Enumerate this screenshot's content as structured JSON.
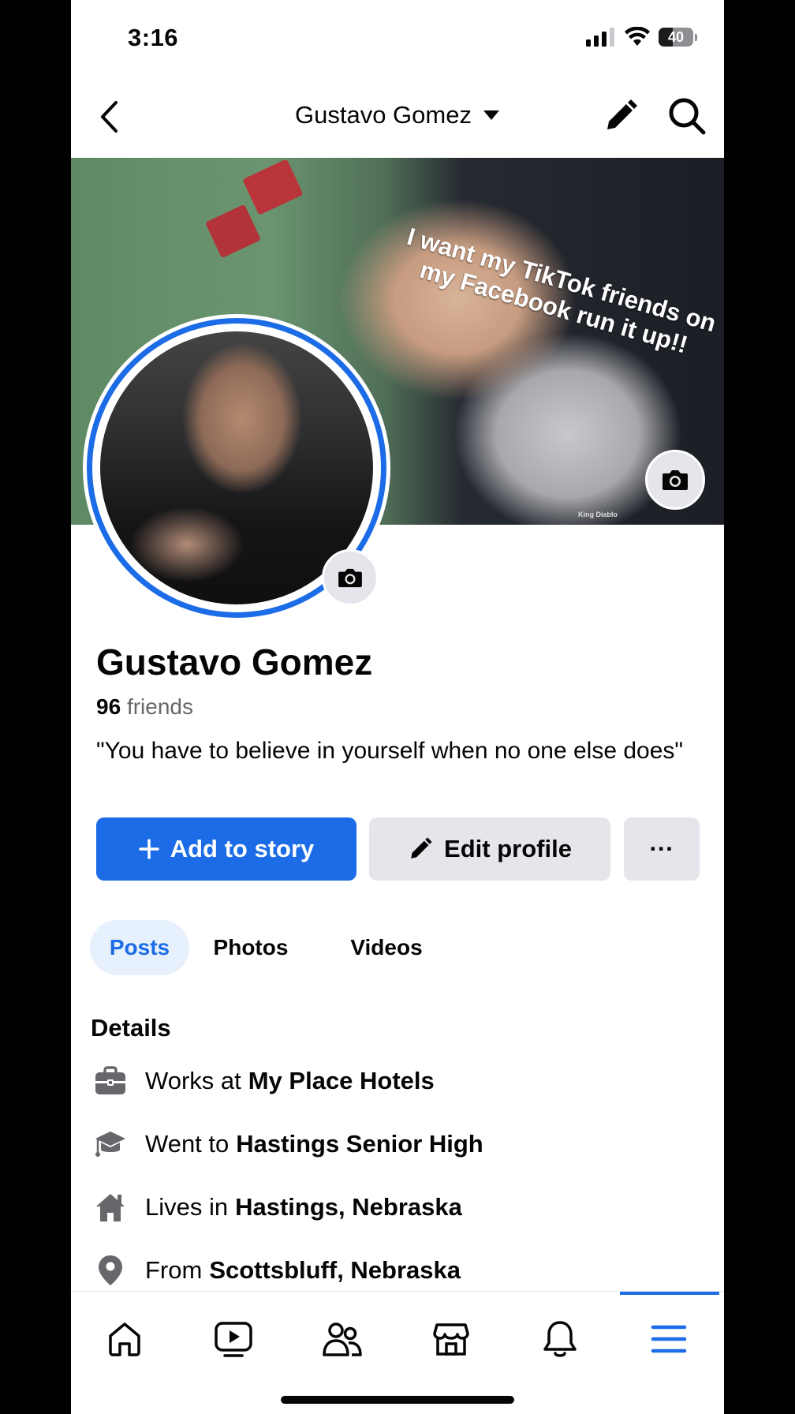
{
  "status_bar": {
    "time": "3:16",
    "battery": "40",
    "battery_level": 0.4
  },
  "header": {
    "title": "Gustavo Gomez"
  },
  "cover": {
    "caption": "I want my TikTok friends on my Facebook run it up!!",
    "watermark": "King Diablo"
  },
  "profile": {
    "name": "Gustavo Gomez",
    "friends_count": "96",
    "friends_label": "friends",
    "bio": "\"You have to believe in yourself when no one else does\""
  },
  "actions": {
    "add_story": "Add to story",
    "edit_profile": "Edit profile",
    "more": "···"
  },
  "tabs": [
    {
      "label": "Posts",
      "active": true
    },
    {
      "label": "Photos",
      "active": false
    },
    {
      "label": "Videos",
      "active": false
    }
  ],
  "details": {
    "title": "Details",
    "items": [
      {
        "icon": "briefcase-icon",
        "prefix": "Works at",
        "value": "My Place Hotels"
      },
      {
        "icon": "graduation-cap-icon",
        "prefix": "Went to",
        "value": "Hastings Senior High"
      },
      {
        "icon": "home-icon",
        "prefix": "Lives in",
        "value": "Hastings, Nebraska"
      },
      {
        "icon": "location-pin-icon",
        "prefix": "From",
        "value": "Scottsbluff, Nebraska"
      }
    ]
  },
  "bottom_nav": {
    "items": [
      "home-icon",
      "video-icon",
      "friends-icon",
      "marketplace-icon",
      "bell-icon",
      "menu-icon"
    ],
    "active": "menu-icon",
    "accent_color": "#1b6ce6"
  }
}
